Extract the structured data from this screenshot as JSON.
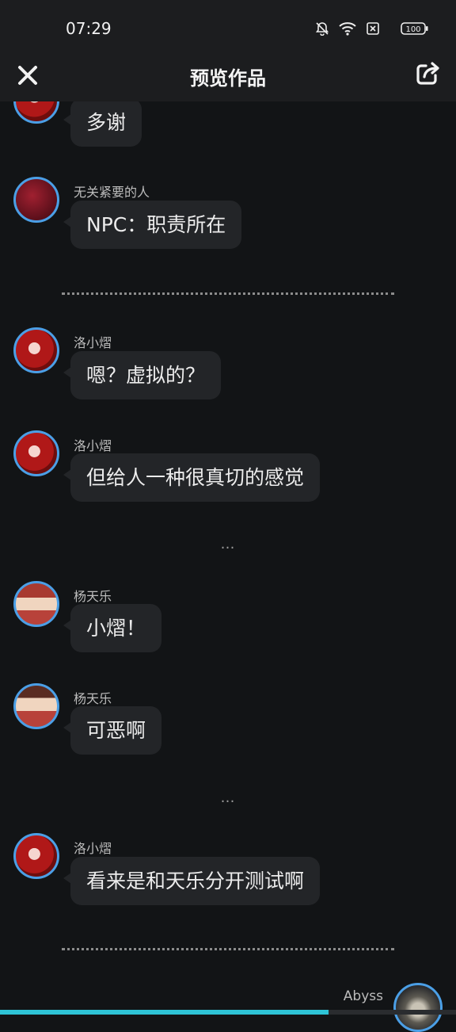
{
  "status_bar": {
    "time": "07:29",
    "battery": "100"
  },
  "header": {
    "title": "预览作品"
  },
  "messages": [
    {
      "avatar": "red",
      "name": "",
      "text": "多谢"
    },
    {
      "avatar": "npc",
      "name": "无关紧要的人",
      "text": "NPC：职责所在"
    },
    {
      "avatar": "red",
      "name": "洛小熠",
      "text": "嗯？虚拟的？"
    },
    {
      "avatar": "red",
      "name": "洛小熠",
      "text": "但给人一种很真切的感觉"
    },
    {
      "avatar": "boy",
      "name": "杨天乐",
      "text": "小熠！"
    },
    {
      "avatar": "boy",
      "name": "杨天乐",
      "text": "可恶啊"
    },
    {
      "avatar": "red",
      "name": "洛小熠",
      "text": "看来是和天乐分开测试啊"
    }
  ],
  "ellipsis": [
    "…",
    "…"
  ],
  "last_sender": {
    "name": "Abyss"
  },
  "progress": {
    "fraction": 0.72
  },
  "colors": {
    "background": "#121416",
    "bubble": "#232528",
    "avatar_ring": "#4b9fe6",
    "progress": "#2ec4d6"
  }
}
